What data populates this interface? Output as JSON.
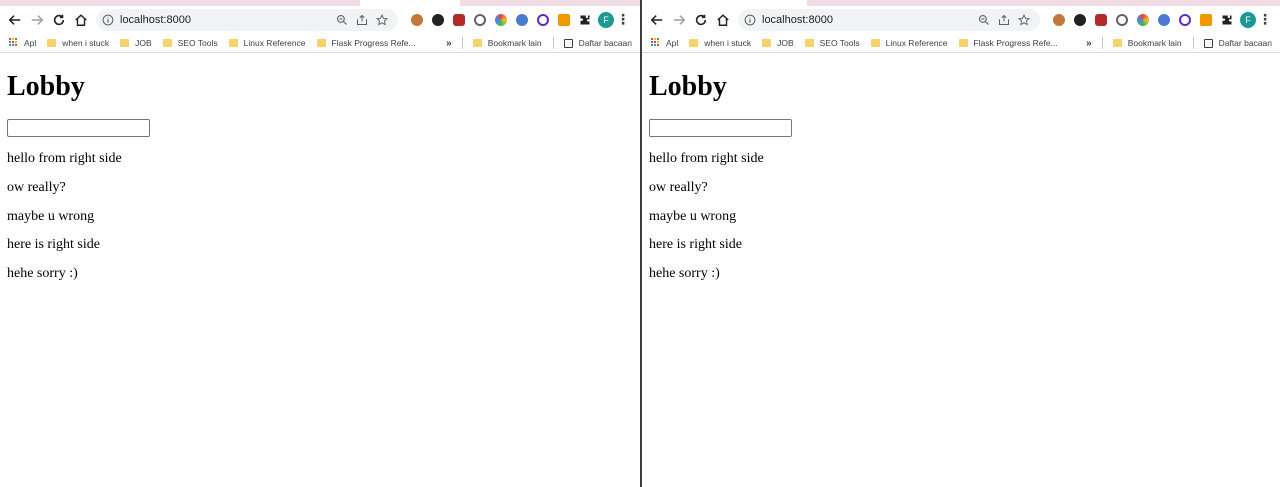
{
  "browser": {
    "url": "localhost:8000",
    "profile_initial": "F",
    "bookmarks": [
      {
        "label": "Apl",
        "type": "apps"
      },
      {
        "label": "when i stuck",
        "type": "folder"
      },
      {
        "label": "JOB",
        "type": "folder"
      },
      {
        "label": "SEO Tools",
        "type": "folder"
      },
      {
        "label": "Linux Reference",
        "type": "folder"
      },
      {
        "label": "Flask Progress Refe...",
        "type": "folder"
      }
    ],
    "bookmarks_overflow": "»",
    "other_bookmarks": "Bookmark lain",
    "reading_list": "Daftar bacaan",
    "extensions": [
      {
        "name": "cookie-extension-icon",
        "color": "#c1783a"
      },
      {
        "name": "w-extension-icon",
        "color": "#202124"
      },
      {
        "name": "ublock-extension-icon",
        "color": "#b22a2a"
      },
      {
        "name": "c-extension-icon",
        "color": "#5f6368"
      },
      {
        "name": "color-wheel-extension-icon",
        "color": "#e8453c"
      },
      {
        "name": "pen-extension-icon",
        "color": "#4a7bd0"
      },
      {
        "name": "c-circle-extension-icon",
        "color": "#5b2bd6"
      },
      {
        "name": "chart-extension-icon",
        "color": "#f29900"
      }
    ]
  },
  "page": {
    "title": "Lobby",
    "input_value": "",
    "messages": [
      "hello from right side",
      "ow really?",
      "maybe u wrong",
      "here is right side",
      "hehe sorry :)"
    ]
  },
  "colors": {
    "tab_strip": "#f1dbe4",
    "omnibox": "#f1f3f4",
    "profile": "#1a9a93",
    "folder": "#f5d36b"
  }
}
